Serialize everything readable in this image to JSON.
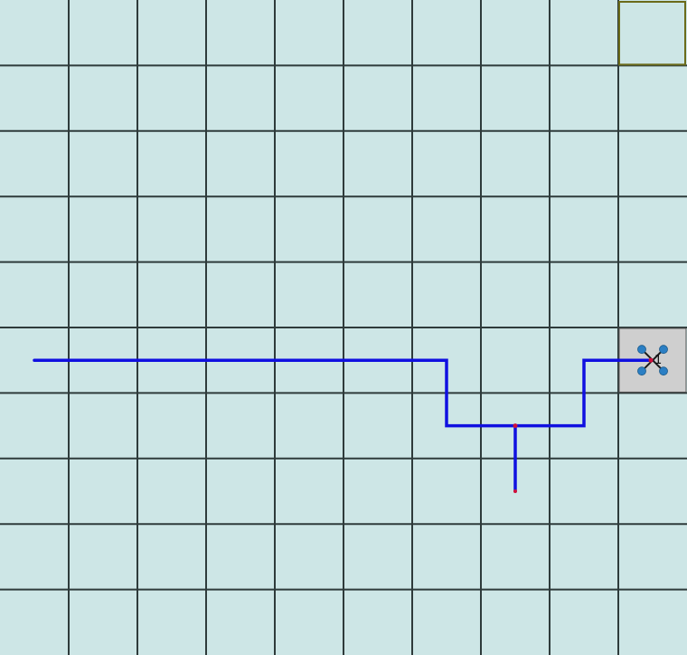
{
  "board": {
    "columns": 10,
    "rows": 10,
    "background_color": "#cde6e6",
    "grid_color": "#2e3b3b",
    "highlight_cell": {
      "col": 9,
      "row": 0,
      "border_color": "#6b6b1a"
    },
    "drone_cell": {
      "col": 9,
      "row": 5,
      "fill": "#cfcfcf"
    }
  },
  "path": {
    "color": "#1010e0",
    "segments": [
      {
        "name": "main-path",
        "points": [
          [
            0.5,
            5.5
          ],
          [
            6.5,
            5.5
          ],
          [
            6.5,
            6.5
          ],
          [
            8.5,
            6.5
          ],
          [
            8.5,
            5.5
          ],
          [
            9.5,
            5.5
          ]
        ]
      },
      {
        "name": "branch-path",
        "points": [
          [
            7.5,
            6.5
          ],
          [
            7.5,
            7.5
          ]
        ]
      }
    ]
  },
  "drone": {
    "icon": "quadcopter-icon",
    "label": "1",
    "rotor_color": "#2b7fc4",
    "arm_color": "#1a1a1a",
    "marker_color": "#d0103a"
  }
}
